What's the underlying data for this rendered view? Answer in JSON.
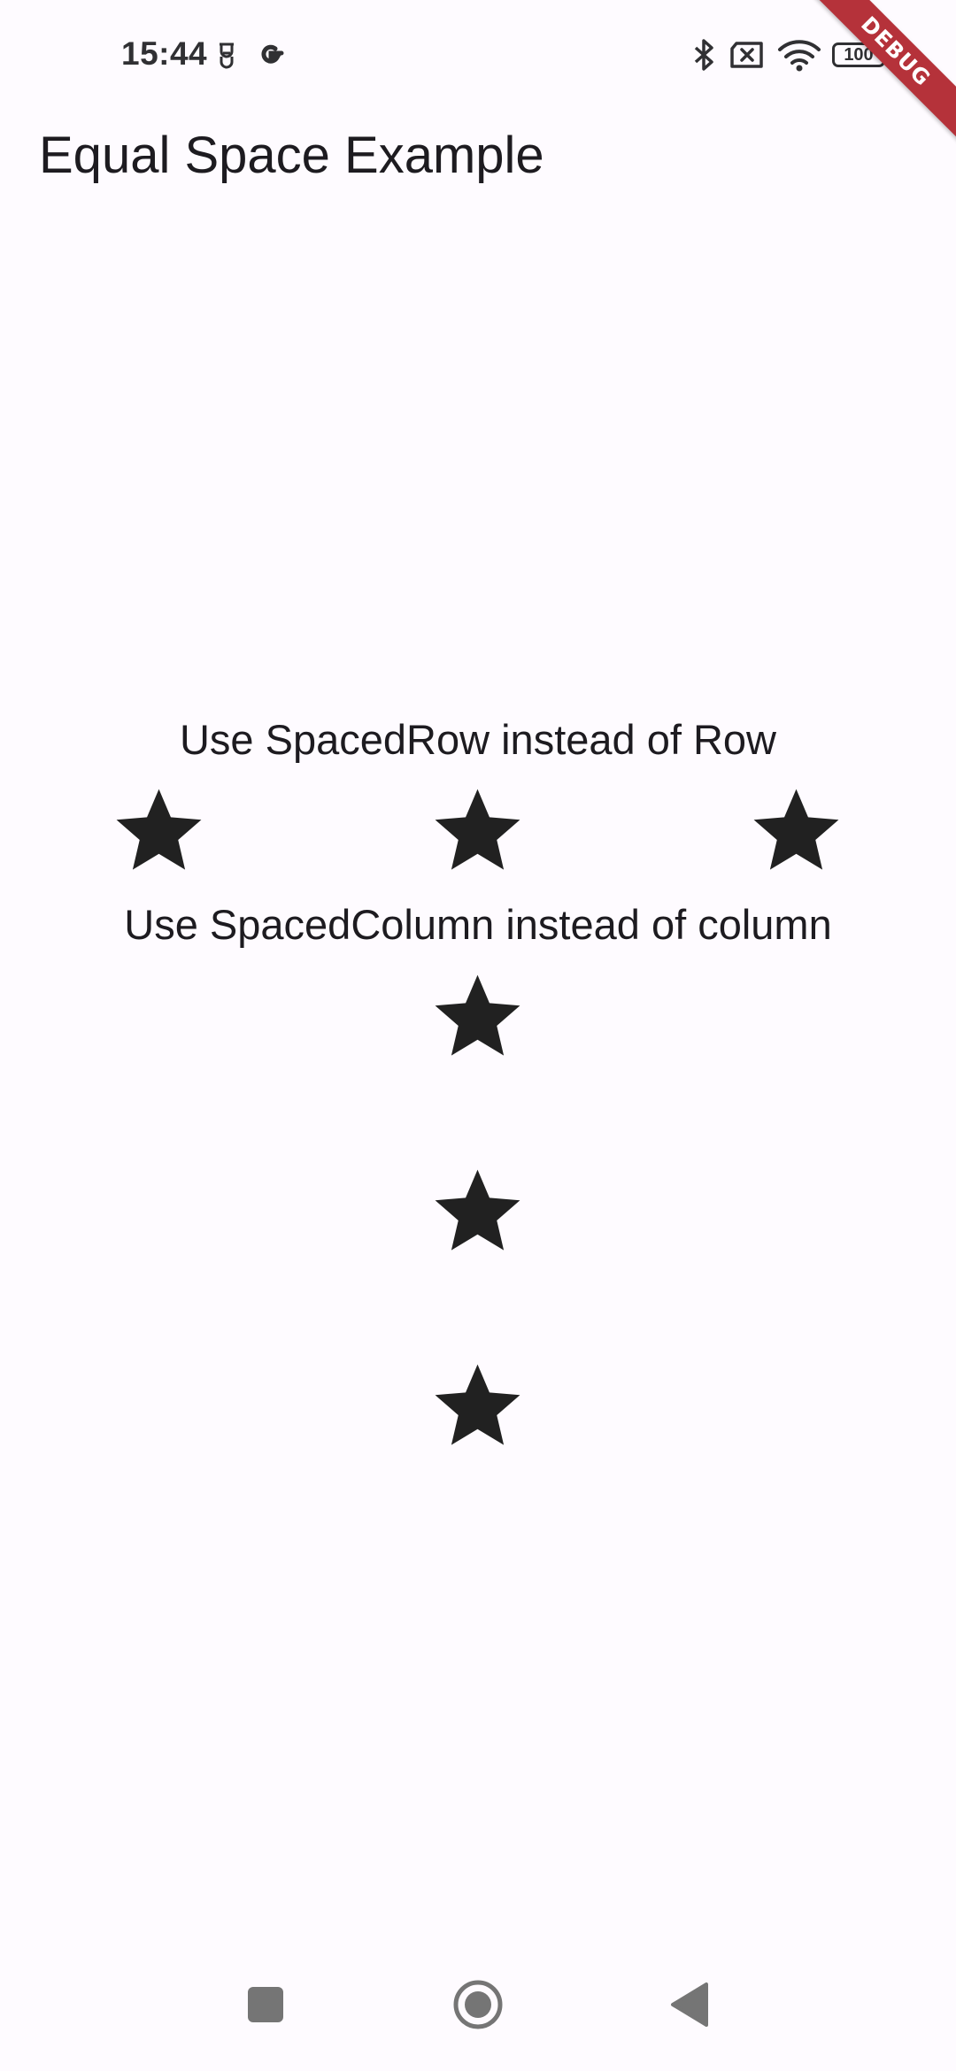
{
  "status_bar": {
    "time": "15:44",
    "battery_level": "100",
    "icons": [
      "silent-mode-icon",
      "google-icon",
      "bluetooth-icon",
      "no-sim-icon",
      "wifi-icon",
      "battery-icon"
    ]
  },
  "debug_banner": {
    "label": "DEBUG",
    "color": "#B5323A"
  },
  "app_bar": {
    "title": "Equal Space Example"
  },
  "spaced_row": {
    "caption": "Use SpacedRow instead of Row",
    "star_count": 3
  },
  "spaced_column": {
    "caption": "Use SpacedColumn instead of column",
    "star_count": 3
  },
  "colors": {
    "background": "#FEFBFF",
    "text": "#1D1B20",
    "star": "#212121",
    "nav_icon": "#757575"
  },
  "nav_bar": {
    "buttons": [
      "recents-button",
      "home-button",
      "back-button"
    ]
  }
}
